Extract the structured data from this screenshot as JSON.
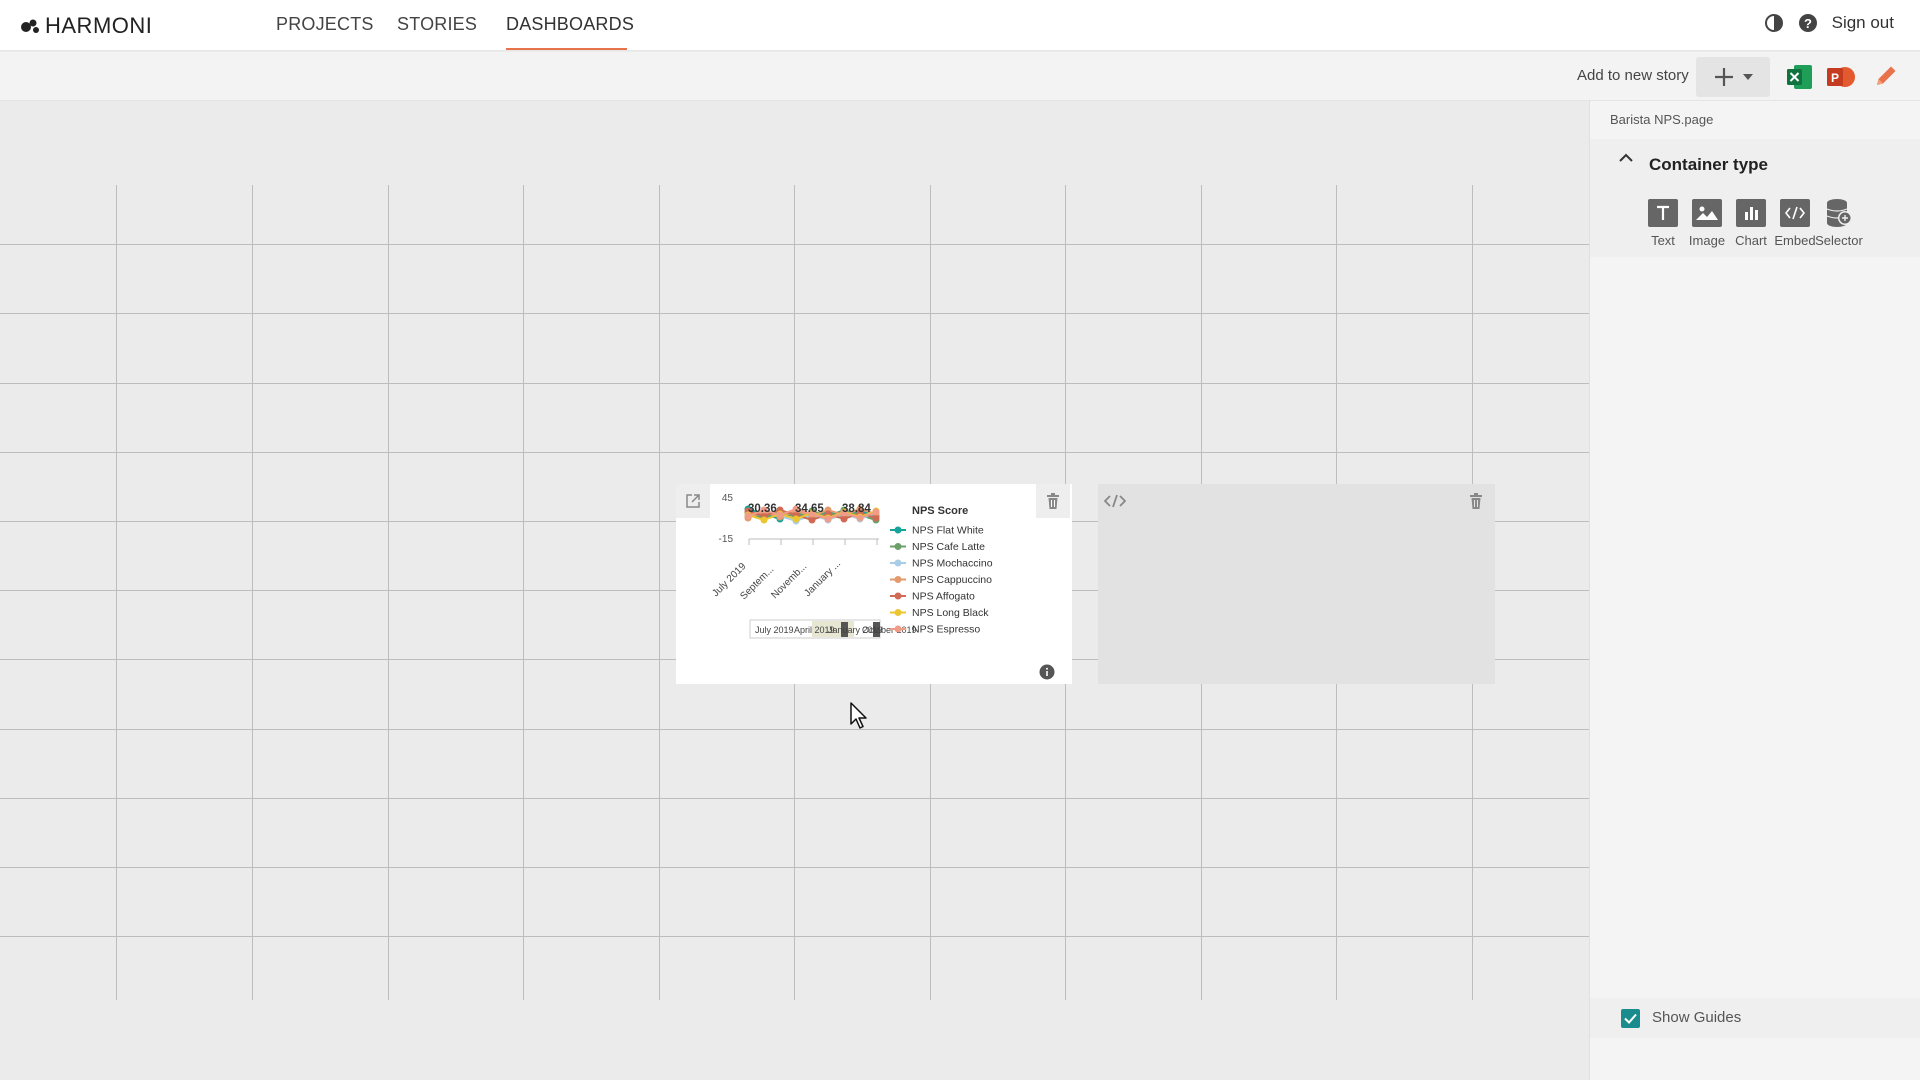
{
  "app": {
    "logo_text": "HARMONI"
  },
  "nav": {
    "tabs": [
      {
        "label": "PROJECTS"
      },
      {
        "label": "STORIES"
      },
      {
        "label": "DASHBOARDS"
      }
    ],
    "active_tab": "DASHBOARDS",
    "sign_out": "Sign out"
  },
  "toolbar": {
    "add_to_story": "Add to new story",
    "icons": [
      "plus-icon",
      "caret-down-icon",
      "excel-icon",
      "powerpoint-icon",
      "edit-pencil-icon"
    ]
  },
  "colors": {
    "accent": "#e8724a",
    "teal": "#1b8c8e"
  },
  "chart_widget": {
    "legend_title": "NPS Score",
    "legend": [
      {
        "name": "NPS Flat White",
        "color": "#16a39a"
      },
      {
        "name": "NPS Cafe Latte",
        "color": "#6c9f6a"
      },
      {
        "name": "NPS Mochaccino",
        "color": "#a9cde6"
      },
      {
        "name": "NPS Cappuccino",
        "color": "#e39a6c"
      },
      {
        "name": "NPS Affogato",
        "color": "#d06a54"
      },
      {
        "name": "NPS Long Black",
        "color": "#ecc631"
      },
      {
        "name": "NPS Espresso",
        "color": "#f19c86"
      }
    ],
    "y_ticks": [
      "45",
      "-15"
    ],
    "x_ticks": [
      "July 2019",
      "Septem...",
      "Novemb...",
      "January ..."
    ],
    "data_labels": [
      "30.36",
      "34.65",
      "38.84"
    ],
    "range_labels": [
      "July 2019",
      "April 2019",
      "January 2019",
      "October 2019"
    ]
  },
  "panel": {
    "page_name": "Barista NPS.page",
    "section_title": "Container type",
    "types": [
      {
        "label": "Text"
      },
      {
        "label": "Image"
      },
      {
        "label": "Chart"
      },
      {
        "label": "Embed"
      },
      {
        "label": "Selector"
      }
    ],
    "show_guides": "Show Guides"
  }
}
